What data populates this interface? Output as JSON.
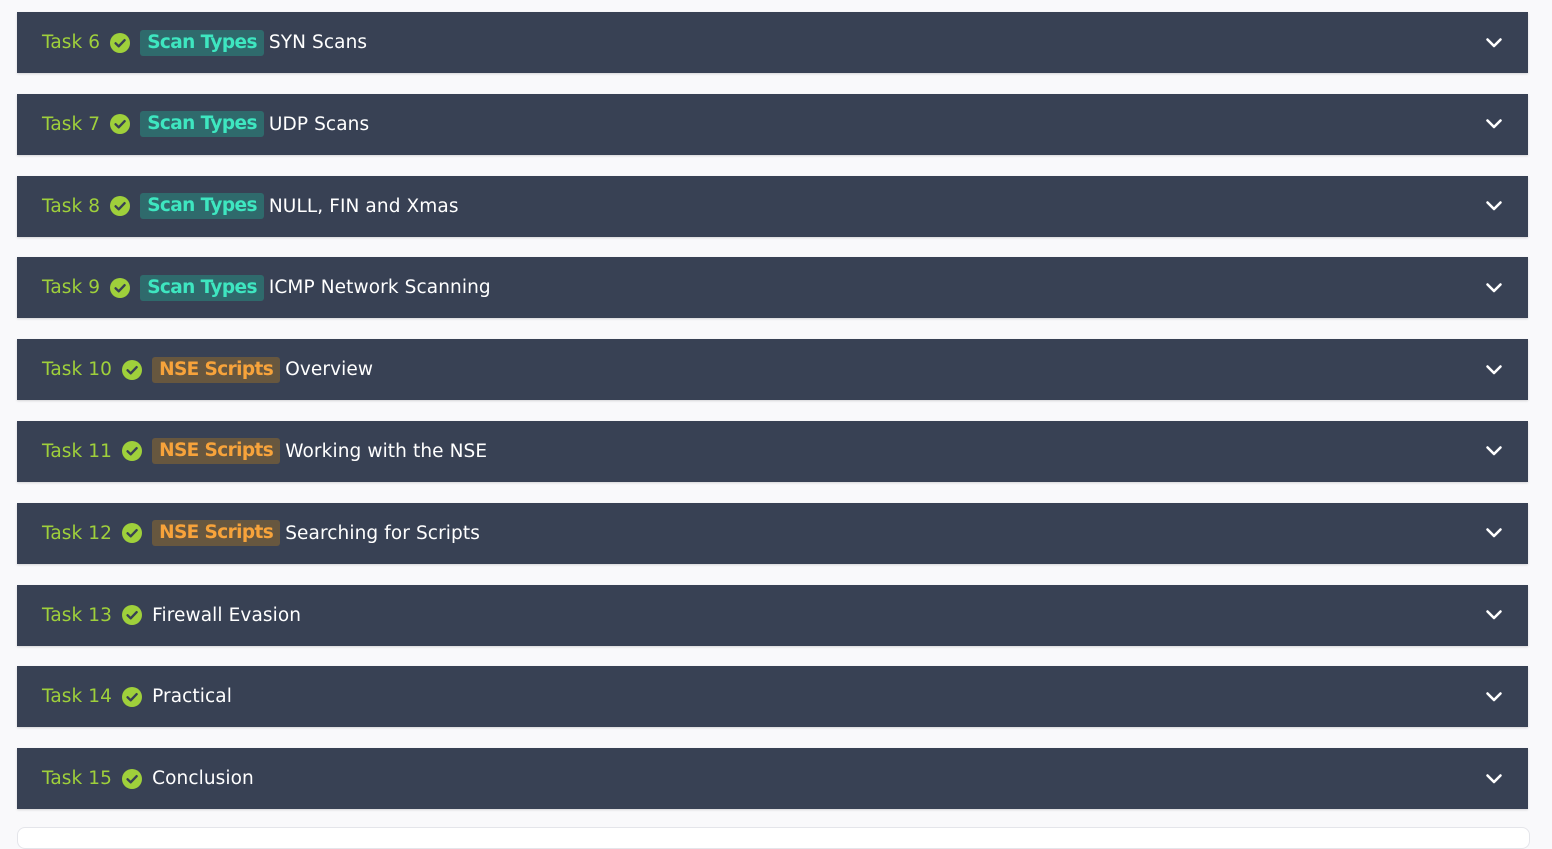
{
  "colors": {
    "row_bg": "#384154",
    "task_number": "#9fd03b",
    "check": "#9fd03b",
    "scan_tag_text": "#3ee6c0",
    "scan_tag_bg": "#2f6a6c",
    "nse_tag_text": "#f7a33b",
    "nse_tag_bg": "#67573f",
    "title": "#ffffff",
    "page_bg": "#f9f9fb"
  },
  "icons": {
    "status": "check-circle-icon",
    "expand": "chevron-down-icon"
  },
  "tasks": [
    {
      "number": "Task 6",
      "tag": "Scan Types",
      "tag_kind": "scan",
      "title": "SYN Scans",
      "completed": true
    },
    {
      "number": "Task 7",
      "tag": "Scan Types",
      "tag_kind": "scan",
      "title": "UDP Scans",
      "completed": true
    },
    {
      "number": "Task 8",
      "tag": "Scan Types",
      "tag_kind": "scan",
      "title": "NULL, FIN and Xmas",
      "completed": true
    },
    {
      "number": "Task 9",
      "tag": "Scan Types",
      "tag_kind": "scan",
      "title": "ICMP Network Scanning",
      "completed": true
    },
    {
      "number": "Task 10",
      "tag": "NSE Scripts",
      "tag_kind": "nse",
      "title": "Overview",
      "completed": true
    },
    {
      "number": "Task 11",
      "tag": "NSE Scripts",
      "tag_kind": "nse",
      "title": "Working with the NSE",
      "completed": true
    },
    {
      "number": "Task 12",
      "tag": "NSE Scripts",
      "tag_kind": "nse",
      "title": "Searching for Scripts",
      "completed": true
    },
    {
      "number": "Task 13",
      "tag": "",
      "tag_kind": "",
      "title": "Firewall Evasion",
      "completed": true
    },
    {
      "number": "Task 14",
      "tag": "",
      "tag_kind": "",
      "title": "Practical",
      "completed": true
    },
    {
      "number": "Task 15",
      "tag": "",
      "tag_kind": "",
      "title": "Conclusion",
      "completed": true
    }
  ]
}
